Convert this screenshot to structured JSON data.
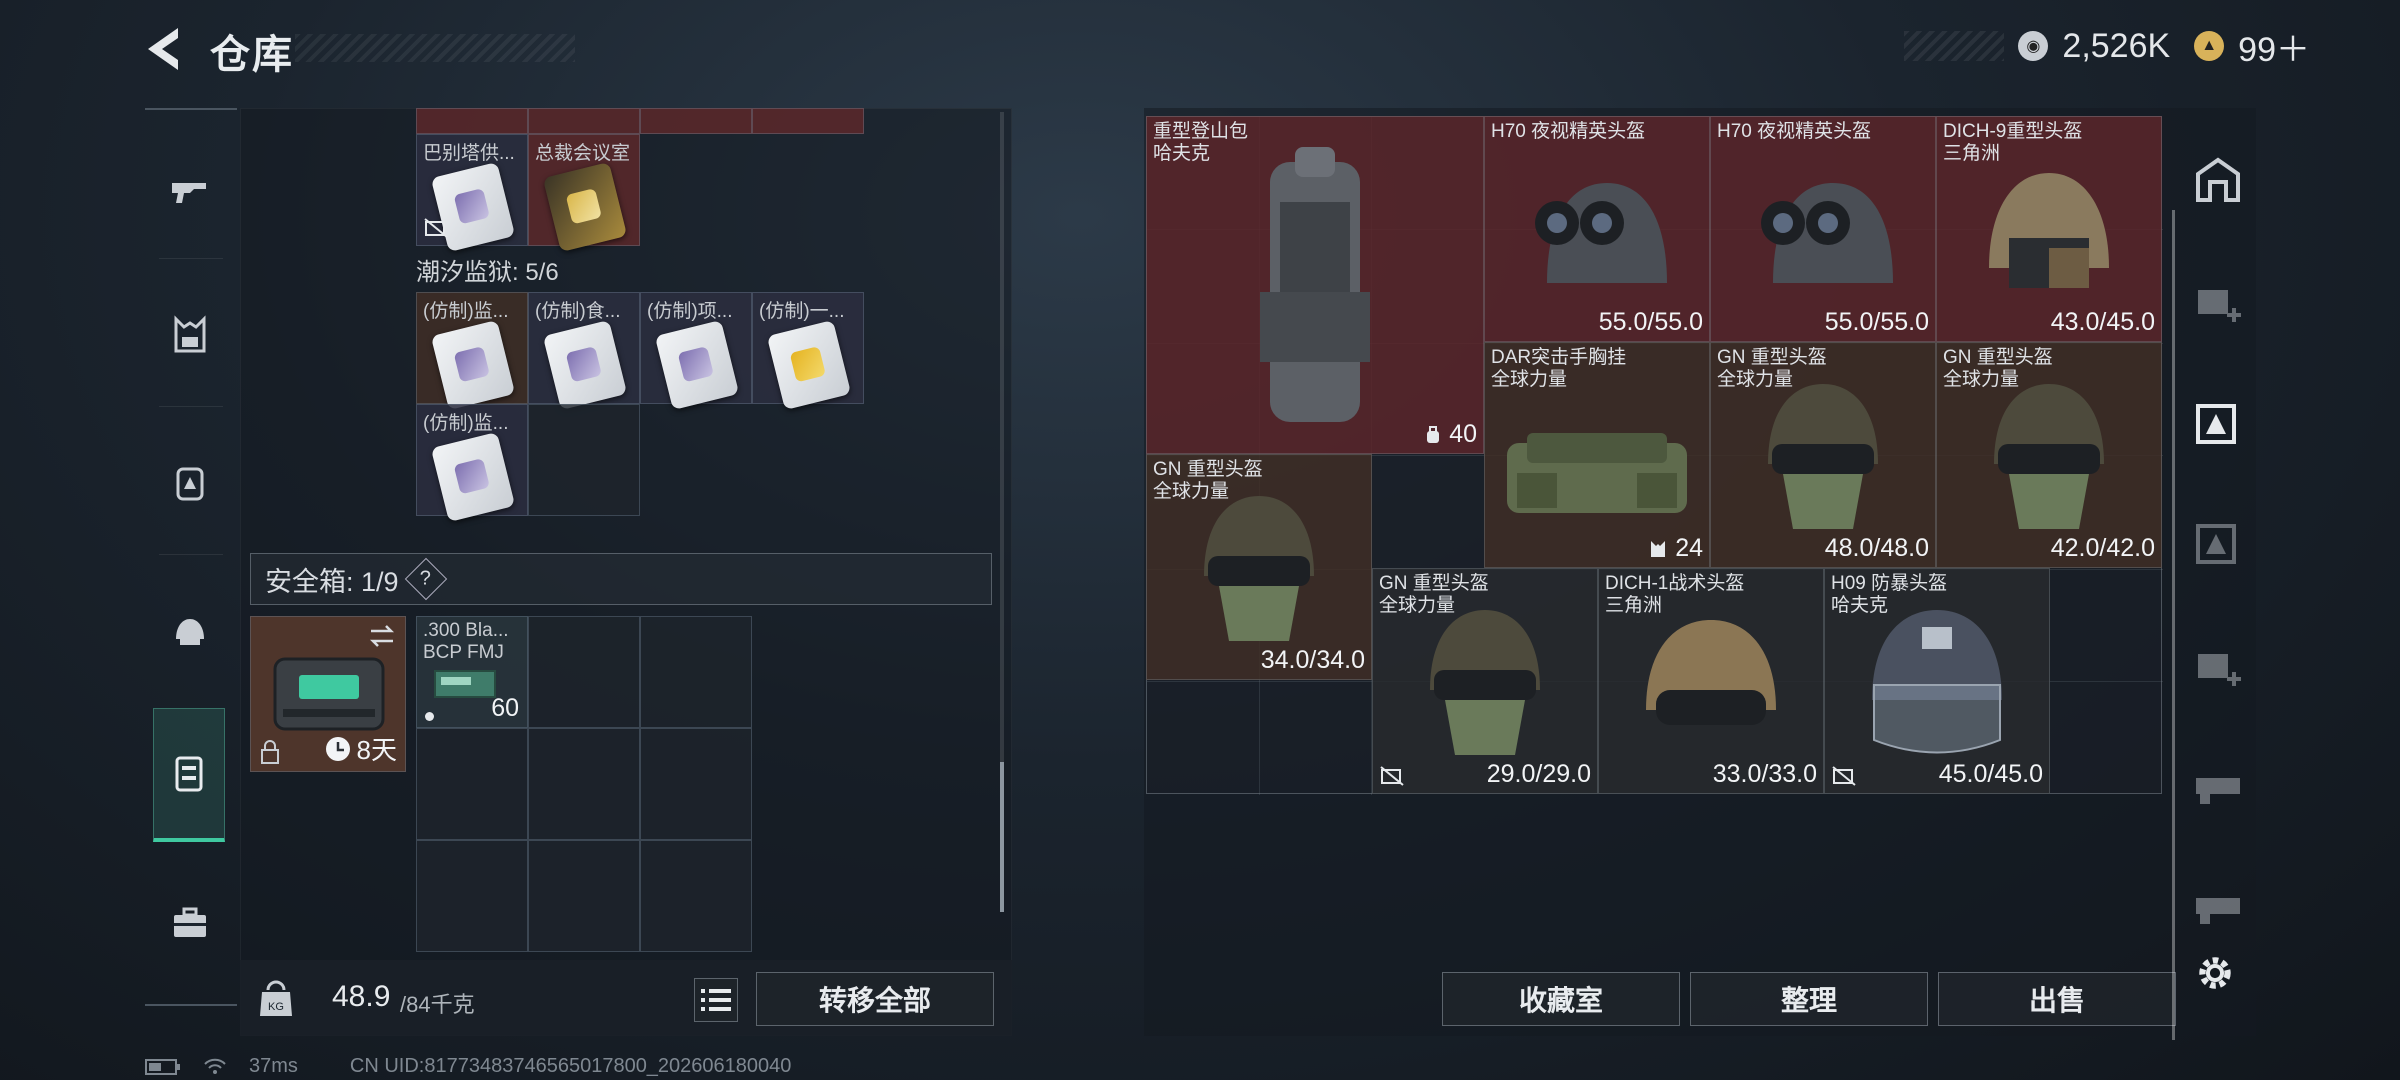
{
  "header": {
    "title": "仓库"
  },
  "currency": {
    "coin_value": "2,526K",
    "ticket_value": "99＋",
    "coin_color": "#c9ced4",
    "ticket_color": "#d8b25a"
  },
  "left_panel": {
    "partial_cells": [
      {
        "label": "巴别塔供..."
      },
      {
        "label": "总裁会议室"
      }
    ],
    "group_title": "潮汐监狱: 5/6",
    "group_cells": [
      {
        "label": "(仿制)监..."
      },
      {
        "label": "(仿制)食..."
      },
      {
        "label": "(仿制)项..."
      },
      {
        "label": "(仿制)一..."
      },
      {
        "label": "(仿制)监..."
      }
    ],
    "safe_box_label": "安全箱: 1/9",
    "help_glyph": "?",
    "case_timer": "8天",
    "ammo": {
      "line1": ".300 Bla...",
      "line2": "BCP FMJ",
      "count": "60"
    },
    "weight_value": "48.9",
    "weight_max": "/84千克",
    "transfer_all_label": "转移全部"
  },
  "right_panel": {
    "items": [
      {
        "name": "重型登山包",
        "sub": "哈夫克",
        "value": "40"
      },
      {
        "name": "H70 夜视精英头盔",
        "sub": "",
        "value": "55.0/55.0"
      },
      {
        "name": "H70 夜视精英头盔",
        "sub": "",
        "value": "55.0/55.0"
      },
      {
        "name": "DICH-9重型头盔",
        "sub": "三角洲",
        "value": "43.0/45.0"
      },
      {
        "name": "DAR突击手胸挂",
        "sub": "全球力量",
        "value": "24"
      },
      {
        "name": "GN 重型头盔",
        "sub": "全球力量",
        "value": "48.0/48.0"
      },
      {
        "name": "GN 重型头盔",
        "sub": "全球力量",
        "value": "42.0/42.0"
      },
      {
        "name": "GN 重型头盔",
        "sub": "全球力量",
        "value": "34.0/34.0"
      },
      {
        "name": "GN 重型头盔",
        "sub": "全球力量",
        "value": "29.0/29.0"
      },
      {
        "name": "DICH-1战术头盔",
        "sub": "三角洲",
        "value": "33.0/33.0"
      },
      {
        "name": "H09 防暴头盔",
        "sub": "哈夫克",
        "value": "45.0/45.0"
      }
    ],
    "buttons": {
      "collection": "收藏室",
      "sort": "整理",
      "sell": "出售"
    }
  },
  "status_bar": {
    "ping": "37ms",
    "uid": "CN UID:8177348374656501780​0_202606180040"
  }
}
